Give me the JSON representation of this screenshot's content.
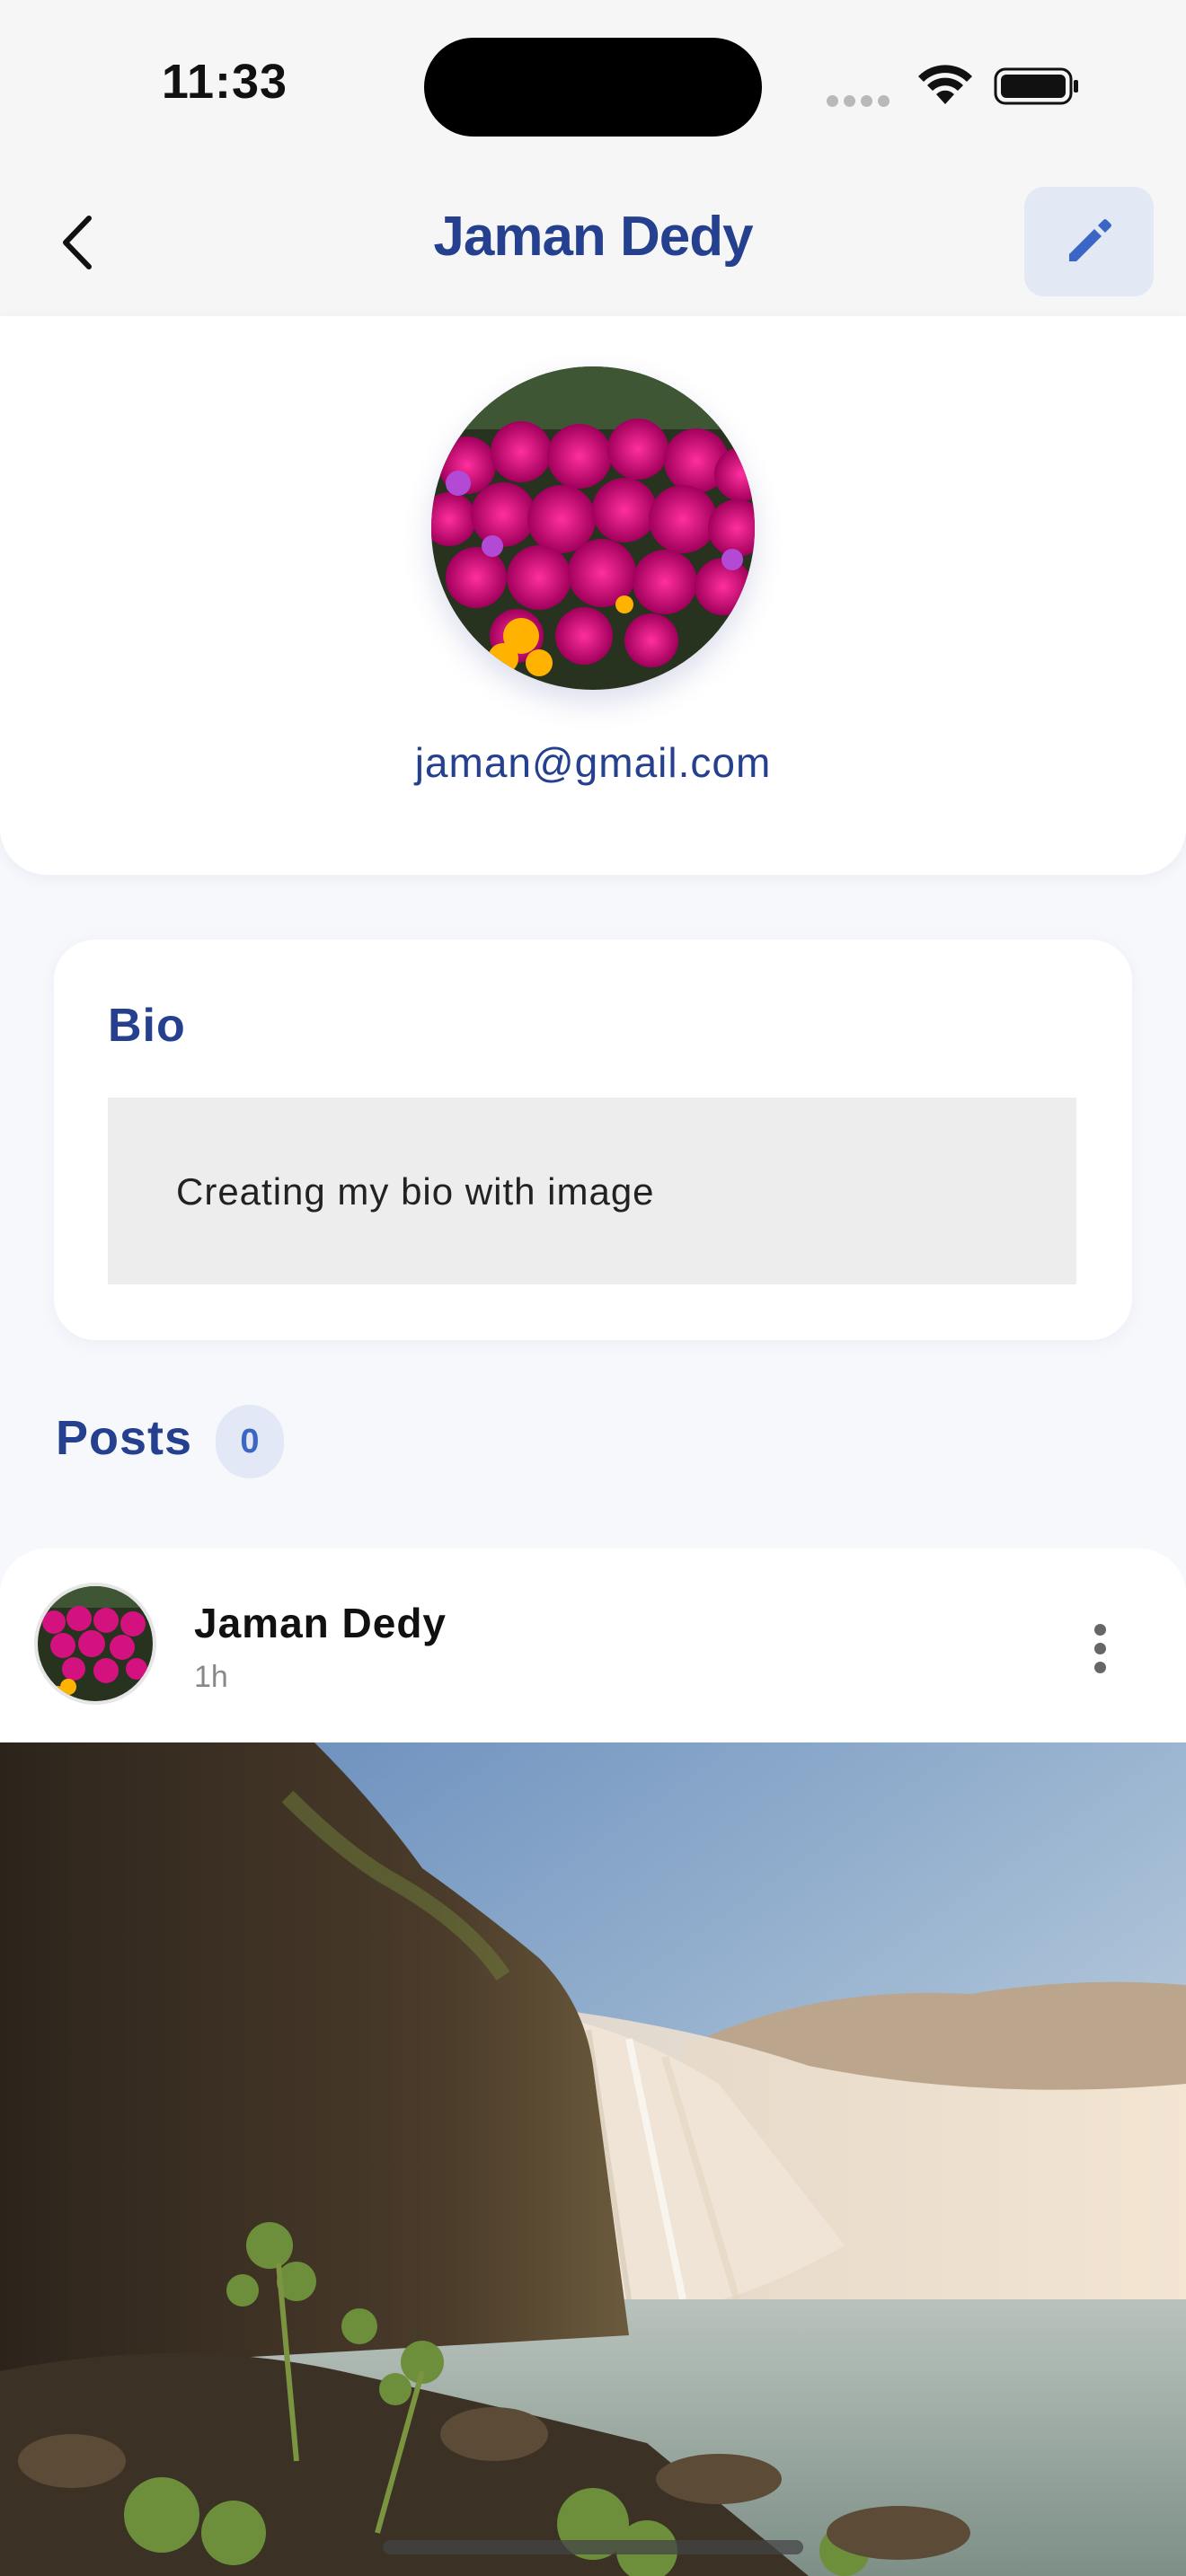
{
  "status_bar": {
    "time": "11:33",
    "icons": [
      "signal-dots-icon",
      "wifi-icon",
      "battery-icon"
    ]
  },
  "header": {
    "title": "Jaman Dedy",
    "back_icon": "chevron-left-icon",
    "edit_icon": "pencil-icon"
  },
  "profile": {
    "email": "jaman@gmail.com",
    "avatar": "flower-photo"
  },
  "bio": {
    "title": "Bio",
    "text": "Creating my bio with image"
  },
  "posts": {
    "title": "Posts",
    "count": "0",
    "items": [
      {
        "author": "Jaman Dedy",
        "time": "1h",
        "image": "waterfall-photo"
      }
    ]
  },
  "colors": {
    "accent": "#24408e",
    "count_badge_bg": "#e2e8f6",
    "edit_button_bg": "#e3e8f5",
    "background": "#f7f8fc"
  }
}
